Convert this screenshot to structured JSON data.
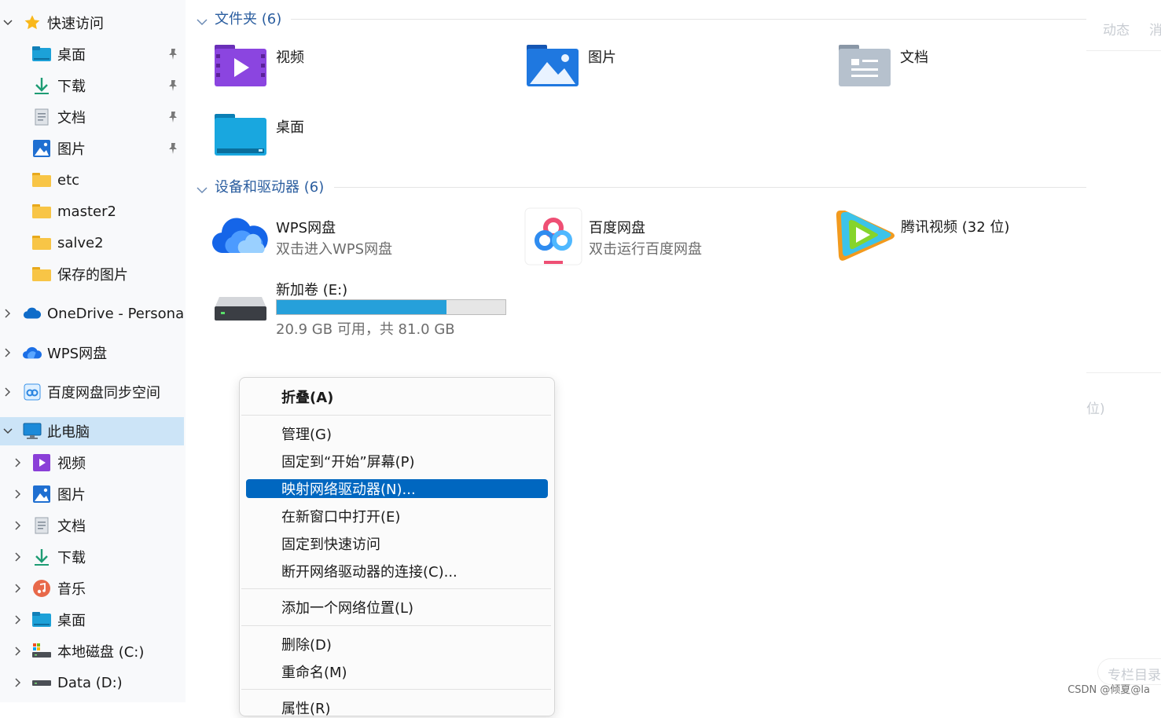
{
  "sidebar": {
    "items": [
      {
        "label": "快速访问",
        "icon": "star-icon"
      },
      {
        "label": "桌面",
        "icon": "desktop-folder-icon",
        "pinned": true
      },
      {
        "label": "下载",
        "icon": "download-icon",
        "pinned": true
      },
      {
        "label": "文档",
        "icon": "document-icon",
        "pinned": true
      },
      {
        "label": "图片",
        "icon": "picture-icon",
        "pinned": true
      },
      {
        "label": "etc",
        "icon": "folder-icon"
      },
      {
        "label": "master2",
        "icon": "folder-icon"
      },
      {
        "label": "salve2",
        "icon": "folder-icon"
      },
      {
        "label": "保存的图片",
        "icon": "folder-icon"
      },
      {
        "label": "OneDrive - Persona",
        "icon": "onedrive-cloud-icon"
      },
      {
        "label": "WPS网盘",
        "icon": "wps-cloud-icon"
      },
      {
        "label": "百度网盘同步空间",
        "icon": "baidu-sync-icon"
      },
      {
        "label": "此电脑",
        "icon": "computer-icon",
        "selected": true
      },
      {
        "label": "视频",
        "icon": "video-icon"
      },
      {
        "label": "图片",
        "icon": "picture-icon"
      },
      {
        "label": "文档",
        "icon": "document-icon"
      },
      {
        "label": "下载",
        "icon": "download-icon"
      },
      {
        "label": "音乐",
        "icon": "music-icon"
      },
      {
        "label": "桌面",
        "icon": "desktop-folder-icon"
      },
      {
        "label": "本地磁盘 (C:)",
        "icon": "local-disk-icon"
      },
      {
        "label": "Data (D:)",
        "icon": "drive-icon"
      }
    ]
  },
  "main": {
    "folders_header": "文件夹 (6)",
    "folders": [
      {
        "name": "视频",
        "icon": "video-folder-icon"
      },
      {
        "name": "图片",
        "icon": "picture-folder-icon"
      },
      {
        "name": "文档",
        "icon": "document-folder-icon"
      },
      {
        "name": "桌面",
        "icon": "desktop-folder-icon"
      }
    ],
    "devices_header": "设备和驱动器 (6)",
    "devices": [
      {
        "name": "WPS网盘",
        "sub": "双击进入WPS网盘",
        "icon": "wps-cloud-icon"
      },
      {
        "name": "百度网盘",
        "sub": "双击运行百度网盘",
        "icon": "baidu-netdisk-icon"
      },
      {
        "name": "腾讯视频 (32 位)",
        "sub": "",
        "icon": "tencent-video-icon"
      }
    ],
    "drive": {
      "name": "新加卷 (E:)",
      "sub": "20.9 GB 可用，共 81.0 GB",
      "used_fraction": 0.742
    }
  },
  "ghost": {
    "top_a": "动态",
    "top_b": "消",
    "mid": "位)",
    "bottom": "专栏目录"
  },
  "context_menu": {
    "items": [
      {
        "label": "折叠(A)",
        "bold": true
      },
      {
        "label": "管理(G)"
      },
      {
        "label": "固定到“开始”屏幕(P)"
      },
      {
        "label": "映射网络驱动器(N)...",
        "highlighted": true
      },
      {
        "label": "在新窗口中打开(E)"
      },
      {
        "label": "固定到快速访问"
      },
      {
        "label": "断开网络驱动器的连接(C)..."
      },
      {
        "label": "添加一个网络位置(L)"
      },
      {
        "label": "删除(D)"
      },
      {
        "label": "重命名(M)"
      },
      {
        "label": "属性(R)"
      }
    ]
  },
  "watermark": "CSDN @倾夏@la",
  "colors": {
    "accent": "#0067c0",
    "selection": "#cce4f7",
    "section_header": "#2a5d9f",
    "drive_fill": "#26a0da"
  }
}
